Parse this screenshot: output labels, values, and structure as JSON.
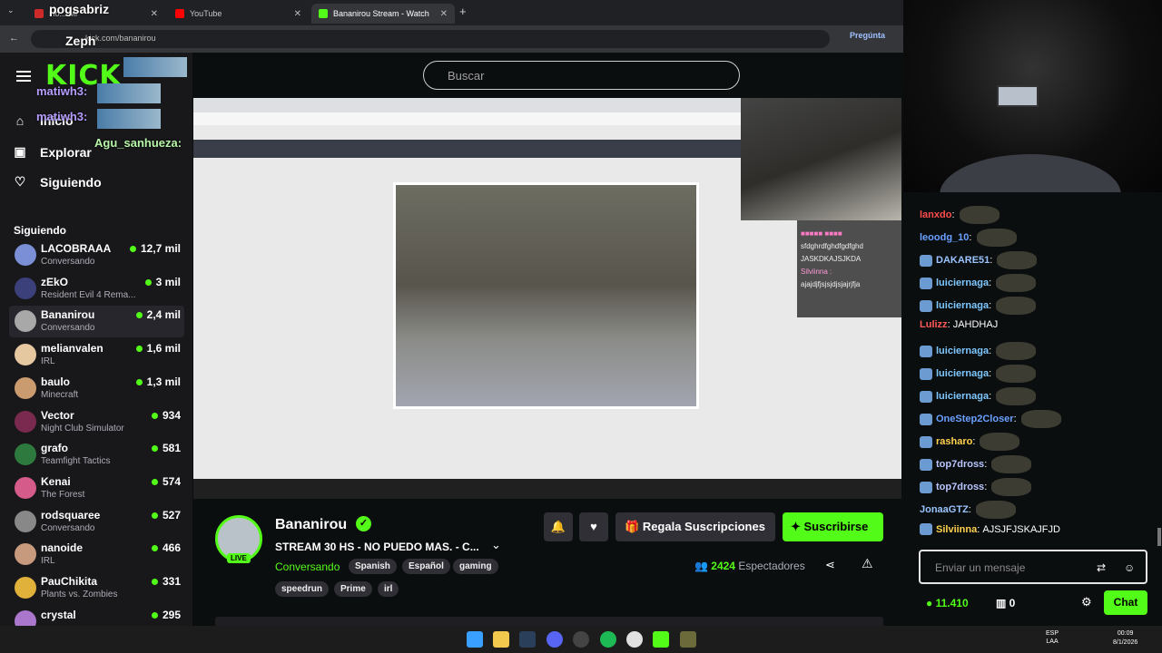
{
  "browser": {
    "tabs": [
      {
        "label": "Ho... Mi",
        "active": false,
        "color": "#cf2a2a"
      },
      {
        "label": "YouTube",
        "active": false,
        "color": "#ff0000"
      },
      {
        "label": "Bananirou Stream - Watch",
        "active": true,
        "color": "#53fc18"
      }
    ],
    "new_tab": "+",
    "url": "kick.com/bananirou",
    "ask_label": "Pregúnta"
  },
  "sidebar": {
    "logo": "KICK",
    "nav": [
      {
        "label": "Inicio",
        "icon": "home-icon"
      },
      {
        "label": "Explorar",
        "icon": "explore-icon"
      },
      {
        "label": "Siguiendo",
        "icon": "heart-icon"
      }
    ],
    "following_heading": "Siguiendo",
    "channels": [
      {
        "name": "LACOBRAAA",
        "category": "Conversando",
        "viewers": "12,7 mil",
        "color": "#7a8fd6"
      },
      {
        "name": "zEkO",
        "category": "Resident Evil 4 Rema...",
        "viewers": "3 mil",
        "color": "#3b3f7a"
      },
      {
        "name": "Bananirou",
        "category": "Conversando",
        "viewers": "2,4 mil",
        "color": "#a8a8a8",
        "selected": true
      },
      {
        "name": "melianvalen",
        "category": "IRL",
        "viewers": "1,6 mil",
        "color": "#e6c8a0"
      },
      {
        "name": "baulo",
        "category": "Minecraft",
        "viewers": "1,3 mil",
        "color": "#c99b6e"
      },
      {
        "name": "Vector",
        "category": "Night Club Simulator",
        "viewers": "934",
        "color": "#7a2a4e"
      },
      {
        "name": "grafo",
        "category": "Teamfight Tactics",
        "viewers": "581",
        "color": "#2e7a3e"
      },
      {
        "name": "Kenai",
        "category": "The Forest",
        "viewers": "574",
        "color": "#d45b8a"
      },
      {
        "name": "rodsquaree",
        "category": "Conversando",
        "viewers": "527",
        "color": "#888888"
      },
      {
        "name": "nanoide",
        "category": "IRL",
        "viewers": "466",
        "color": "#c79a7d"
      },
      {
        "name": "PauChikita",
        "category": "Plants vs. Zombies",
        "viewers": "331",
        "color": "#e0b23c"
      },
      {
        "name": "crystal",
        "category": "",
        "viewers": "295",
        "color": "#aa77cc"
      }
    ],
    "overlay_names": [
      "pogsabriz",
      "Zeph",
      "matiwh3:",
      "matiwh3:",
      "Agu_sanhueza:"
    ]
  },
  "search": {
    "placeholder": "Buscar"
  },
  "stream": {
    "streamer": "Bananirou",
    "title": "STREAM 30 HS - NO PUEDO MAS. - C...",
    "category": "Conversando",
    "live_label": "LIVE",
    "tags": [
      "Spanish",
      "Español",
      "gaming",
      "speedrun",
      "Prime",
      "irl"
    ],
    "gift_label": "Regala Suscripciones",
    "subscribe_label": "Suscribirse",
    "viewers_count": "2424",
    "viewers_label": "Espectadores"
  },
  "video_overlay_chat": {
    "lines": [
      "sfdghrdfghdfgdfghd",
      "JASKDKAJSJKDA",
      "Silviinna :",
      "ajajdjfjsjsjdjsjajrjfja"
    ]
  },
  "chat": {
    "messages": [
      {
        "user": "lanxdo",
        "color": "#ff4d4d",
        "text": ""
      },
      {
        "user": "leoodg_10",
        "color": "#6aa0ff",
        "text": ""
      },
      {
        "user": "DAKARE51",
        "color": "#9ac4ff",
        "text": ""
      },
      {
        "user": "luiciernaga",
        "color": "#7ec7ff",
        "text": ""
      },
      {
        "user": "luiciernaga",
        "color": "#7ec7ff",
        "text": ""
      },
      {
        "user": "Lulizz",
        "color": "#ff5a5a",
        "text": "JAHDHAJ"
      },
      {
        "user": "luiciernaga",
        "color": "#7ec7ff",
        "text": ""
      },
      {
        "user": "luiciernaga",
        "color": "#7ec7ff",
        "text": ""
      },
      {
        "user": "luiciernaga",
        "color": "#7ec7ff",
        "text": ""
      },
      {
        "user": "OneStep2Closer",
        "color": "#6aa0ff",
        "text": ""
      },
      {
        "user": "rasharo",
        "color": "#ffd24d",
        "text": ""
      },
      {
        "user": "top7dross",
        "color": "#b9c6ff",
        "text": ""
      },
      {
        "user": "top7dross",
        "color": "#b9c6ff",
        "text": ""
      },
      {
        "user": "JonaaGTZ",
        "color": "#9ac4ff",
        "text": ""
      },
      {
        "user": "Silviinna",
        "color": "#ffd24d",
        "text": "AJSJFJSKAJFJD"
      }
    ],
    "input_placeholder": "Enviar un mensaje",
    "points": "11.410",
    "subs": "0",
    "chat_button": "Chat"
  },
  "taskbar": {
    "lang": "ESP",
    "lang2": "LAA",
    "time": "00:09",
    "date": "8/1/2026"
  }
}
